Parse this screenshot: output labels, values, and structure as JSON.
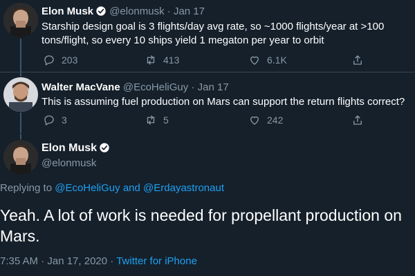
{
  "colors": {
    "background": "#15202b",
    "secondary_text": "#8899a6",
    "link": "#1da1f2",
    "verified": "#1da1f2",
    "separator": "#38444d"
  },
  "tweets": [
    {
      "author_name": "Elon Musk",
      "verified": true,
      "handle": "@elonmusk",
      "date": "Jan 17",
      "text_lines": [
        "Starship design goal is 3 flights/day avg rate, so ~1000 flights/year at >100",
        "tons/flight, so every 10 ships yield 1 megaton per year to orbit"
      ],
      "replies": "203",
      "retweets": "413",
      "likes": "6.1K",
      "icons": [
        "reply-icon",
        "retweet-icon",
        "like-icon",
        "share-icon"
      ]
    },
    {
      "author_name": "Walter MacVane",
      "verified": false,
      "handle": "@EcoHeliGuy",
      "date": "Jan 17",
      "text": "This is assuming fuel production on Mars can support the return flights correct?",
      "replies": "3",
      "retweets": "5",
      "likes": "242",
      "icons": [
        "reply-icon",
        "retweet-icon",
        "like-icon",
        "share-icon"
      ]
    }
  ],
  "main_tweet": {
    "author_name": "Elon Musk",
    "verified": true,
    "handle": "@elonmusk",
    "replying_prefix": "Replying to",
    "mention_1": "@EcoHeliGuy",
    "replying_and": "and",
    "mention_2": "@Erdayastronaut",
    "text_line_1": "Yeah. A lot of work is needed for propellant production on",
    "text_line_2": "Mars.",
    "timestamp": "7:35 AM · Jan 17, 2020 ·",
    "source": "Twitter for iPhone"
  }
}
